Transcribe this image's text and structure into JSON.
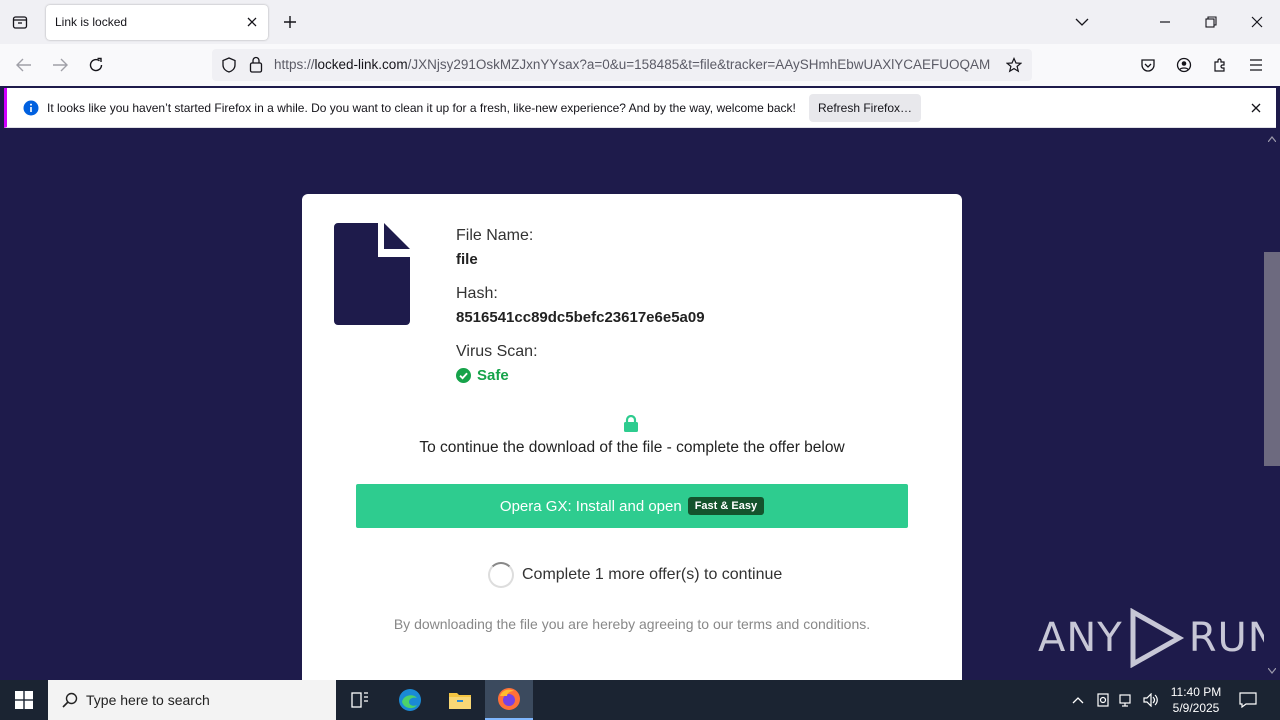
{
  "browser": {
    "tab_title": "Link is locked",
    "url_prefix": "https://",
    "url_host": "locked-link.com",
    "url_rest": "/JXNjsy291OskMZJxnYYsax?a=0&u=158485&t=file&tracker=AAySHmhEbwUAXlYCAEFUOQAM",
    "notice_text": "It looks like you haven’t started Firefox in a while. Do you want to clean it up for a fresh, like-new experience? And by the way, welcome back!",
    "notice_button": "Refresh Firefox…"
  },
  "card": {
    "file_name_label": "File Name:",
    "file_name_value": "file",
    "hash_label": "Hash:",
    "hash_value": "8516541cc89dc5befc23617e6e5a09",
    "virus_scan_label": "Virus Scan:",
    "virus_scan_value": "Safe",
    "offer_message": "To continue the download of the file - complete the offer below",
    "offer_button_text": "Opera GX: Install and open",
    "offer_badge": "Fast & Easy",
    "progress_text": "Complete 1 more offer(s) to continue",
    "terms_text": "By downloading the file you are hereby agreeing to our terms and conditions."
  },
  "watermark": {
    "left": "ANY",
    "right": "RUN"
  },
  "taskbar": {
    "search_placeholder": "Type here to search",
    "time": "11:40 PM",
    "date": "5/9/2025"
  },
  "colors": {
    "page_bg": "#1e1b4b",
    "accent_green": "#2ecc8f",
    "safe_green": "#16a34a",
    "file_icon": "#1e1b4b"
  }
}
